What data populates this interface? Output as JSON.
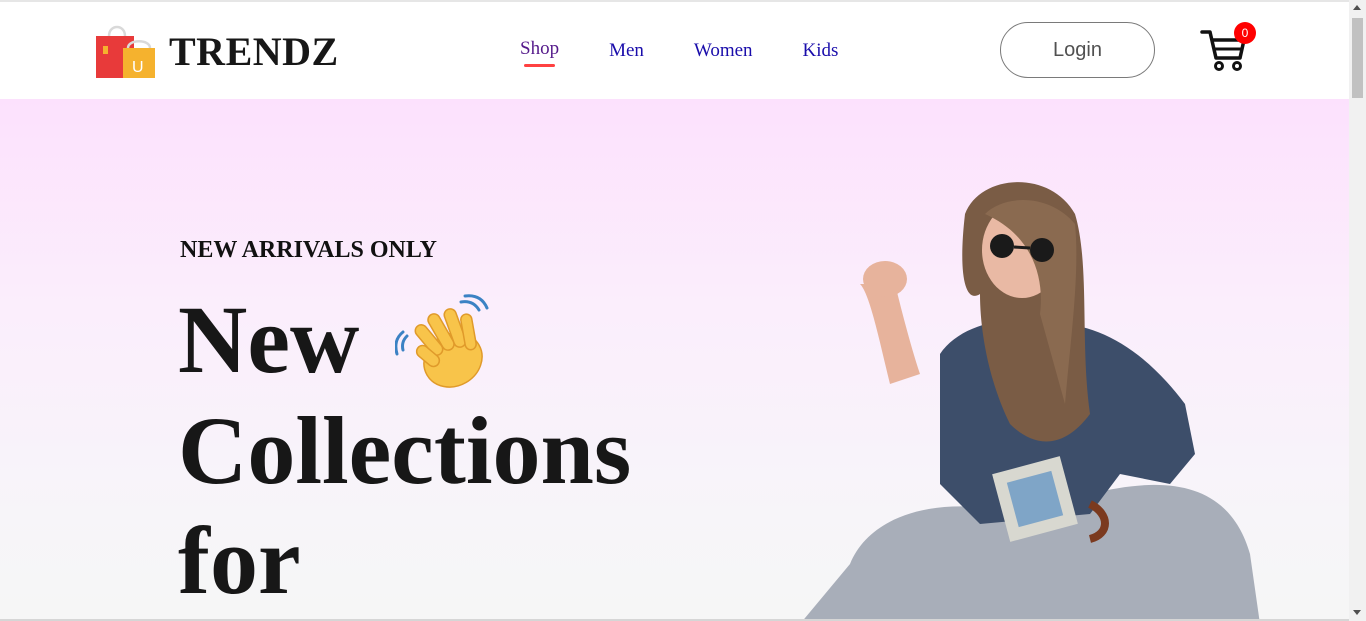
{
  "brand": {
    "name": "TRENDZ",
    "logo_letter": "U"
  },
  "nav": {
    "items": [
      {
        "label": "Shop",
        "active": true
      },
      {
        "label": "Men",
        "active": false
      },
      {
        "label": "Women",
        "active": false
      },
      {
        "label": "Kids",
        "active": false
      }
    ]
  },
  "header": {
    "login_label": "Login",
    "cart_count": "0"
  },
  "hero": {
    "kicker": "NEW ARRIVALS ONLY",
    "line1": "New",
    "line2": "Collections",
    "line3": "for"
  },
  "colors": {
    "accent": "#ff4141",
    "badge": "#ff0000",
    "hero_top": "#fce1fd",
    "hero_bottom": "#f6f6f6"
  },
  "icons": {
    "logo": "shopping-bag-icon",
    "cart": "cart-icon",
    "hero_emoji": "waving-hand-icon"
  }
}
